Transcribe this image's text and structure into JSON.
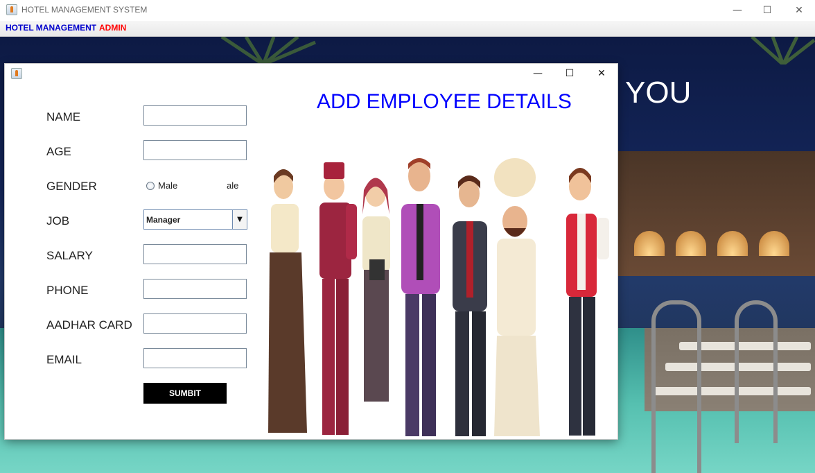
{
  "main_window": {
    "title": "HOTEL MANAGEMENT SYSTEM",
    "controls": {
      "minimize": "—",
      "maximize": "☐",
      "close": "✕"
    }
  },
  "menubar": {
    "items": [
      {
        "label": "HOTEL MANAGEMENT",
        "color": "#0000cc"
      },
      {
        "label": "ADMIN",
        "color": "#ff0000"
      }
    ]
  },
  "background": {
    "text": "YOU"
  },
  "dialog": {
    "controls": {
      "minimize": "—",
      "maximize": "☐",
      "close": "✕"
    },
    "heading": "ADD EMPLOYEE DETAILS",
    "fields": {
      "name": {
        "label": "NAME",
        "value": ""
      },
      "age": {
        "label": "AGE",
        "value": ""
      },
      "gender": {
        "label": "GENDER",
        "options": [
          "Male",
          "ale"
        ],
        "selected": null
      },
      "job": {
        "label": "JOB",
        "value": "Manager",
        "arrow": "▼"
      },
      "salary": {
        "label": "SALARY",
        "value": ""
      },
      "phone": {
        "label": "PHONE",
        "value": ""
      },
      "aadhar": {
        "label": "AADHAR CARD",
        "value": ""
      },
      "email": {
        "label": "EMAIL",
        "value": ""
      }
    },
    "submit_label": "SUMBIT",
    "illustration": "hotel-staff-illustration"
  }
}
